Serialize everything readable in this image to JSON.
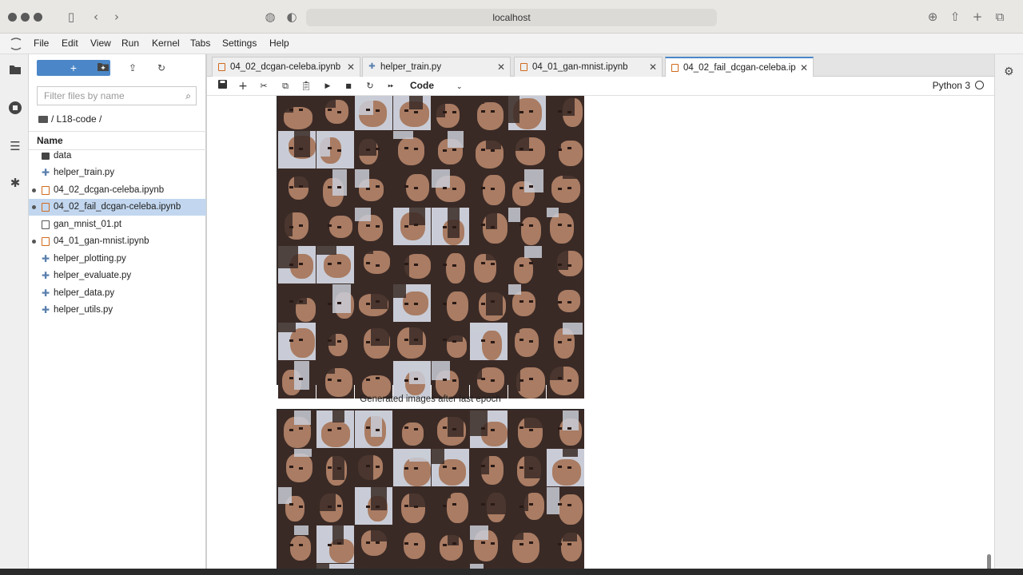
{
  "browser": {
    "url": "localhost",
    "icons": [
      "sidebar-icon",
      "back-icon",
      "forward-icon",
      "privacy-icon",
      "shield-icon",
      "download-icon",
      "share-icon",
      "new-tab-icon",
      "tabs-overview-icon"
    ]
  },
  "menubar": {
    "items": [
      "File",
      "Edit",
      "View",
      "Run",
      "Kernel",
      "Tabs",
      "Settings",
      "Help"
    ]
  },
  "filebrowser": {
    "new_label": "+",
    "filter_placeholder": "Filter files by name",
    "breadcrumb": "/ L18-code /",
    "header": "Name",
    "files": [
      {
        "name": "data",
        "type": "folder",
        "running": false,
        "selected": false
      },
      {
        "name": "helper_train.py",
        "type": "python",
        "running": false,
        "selected": false
      },
      {
        "name": "04_02_dcgan-celeba.ipynb",
        "type": "notebook",
        "running": true,
        "selected": false
      },
      {
        "name": "04_02_fail_dcgan-celeba.ipynb",
        "type": "notebook",
        "running": true,
        "selected": true
      },
      {
        "name": "gan_mnist_01.pt",
        "type": "file",
        "running": false,
        "selected": false
      },
      {
        "name": "04_01_gan-mnist.ipynb",
        "type": "notebook",
        "running": true,
        "selected": false
      },
      {
        "name": "helper_plotting.py",
        "type": "python",
        "running": false,
        "selected": false
      },
      {
        "name": "helper_evaluate.py",
        "type": "python",
        "running": false,
        "selected": false
      },
      {
        "name": "helper_data.py",
        "type": "python",
        "running": false,
        "selected": false
      },
      {
        "name": "helper_utils.py",
        "type": "python",
        "running": false,
        "selected": false
      }
    ]
  },
  "tabs": [
    {
      "label": "04_02_dcgan-celeba.ipynb",
      "type": "notebook",
      "active": false
    },
    {
      "label": "helper_train.py",
      "type": "python",
      "active": false
    },
    {
      "label": "04_01_gan-mnist.ipynb",
      "type": "notebook",
      "active": false
    },
    {
      "label": "04_02_fail_dcgan-celeba.ip",
      "type": "notebook",
      "active": true
    }
  ],
  "notebook_toolbar": {
    "cell_type": "Code",
    "kernel": "Python 3"
  },
  "output": {
    "second_figure_title": "Generated images after last epoch"
  },
  "colors": {
    "accent": "#4b87c8",
    "selected_row": "#c2d7ef",
    "notebook_icon": "#d06a1e",
    "skin": "#a97c63",
    "dark_hair": "#3a2a26",
    "highlight": "#c9ccd6"
  }
}
